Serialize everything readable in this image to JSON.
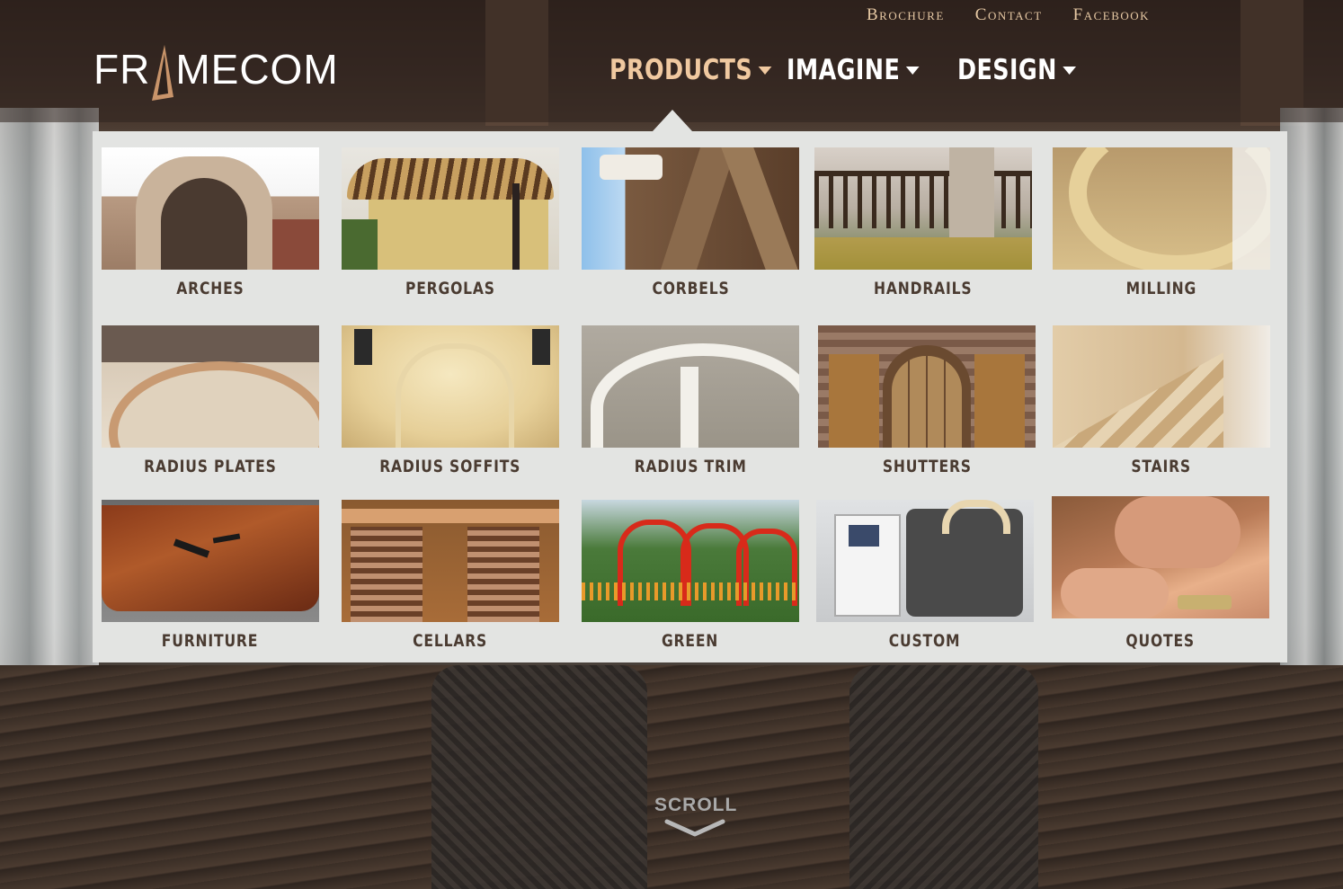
{
  "brand": {
    "logo_text_left": "FR",
    "logo_text_right": "MECOM"
  },
  "top_nav": [
    {
      "label": "Brochure"
    },
    {
      "label": "Contact"
    },
    {
      "label": "Facebook"
    }
  ],
  "main_nav": [
    {
      "label": "PRODUCTS",
      "active": true
    },
    {
      "label": "IMAGINE",
      "active": false
    },
    {
      "label": "DESIGN",
      "active": false
    }
  ],
  "products_menu": {
    "items": [
      {
        "label": "ARCHES"
      },
      {
        "label": "PERGOLAS"
      },
      {
        "label": "CORBELS"
      },
      {
        "label": "HANDRAILS"
      },
      {
        "label": "MILLING"
      },
      {
        "label": "RADIUS PLATES"
      },
      {
        "label": "RADIUS SOFFITS"
      },
      {
        "label": "RADIUS TRIM"
      },
      {
        "label": "SHUTTERS"
      },
      {
        "label": "STAIRS"
      },
      {
        "label": "FURNITURE"
      },
      {
        "label": "CELLARS"
      },
      {
        "label": "GREEN"
      },
      {
        "label": "CUSTOM"
      },
      {
        "label": "QUOTES"
      }
    ]
  },
  "scroll": {
    "label": "SCROLL",
    "icon": "chevron-down-icon"
  },
  "colors": {
    "accent_active": "#f0c9a0",
    "top_nav": "#e7c9a4",
    "panel_bg": "#e3e4e2",
    "label_text": "#4a3b31"
  }
}
